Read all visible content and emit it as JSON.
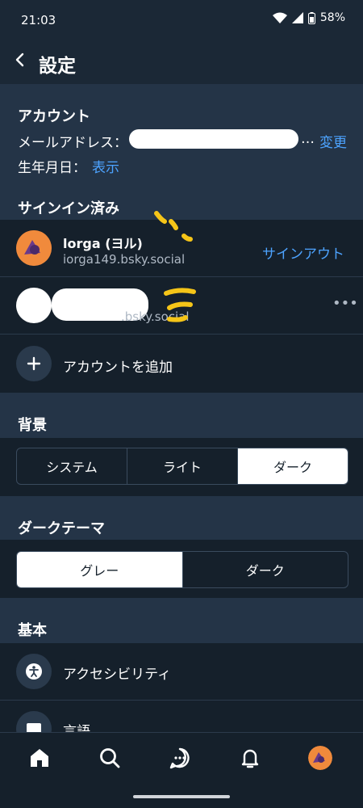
{
  "status": {
    "time": "21:03",
    "battery": "58%"
  },
  "header": {
    "title": "設定"
  },
  "account": {
    "heading": "アカウント",
    "email_label": "メールアドレス：",
    "email_ellipsis": "…",
    "change_link": "変更",
    "birthday_label": "生年月日：",
    "birthday_link": "表示"
  },
  "signed_in": {
    "heading": "サインイン済み",
    "accounts": [
      {
        "name": "lorga (ヨル)",
        "handle": "iorga149.bsky.social",
        "action": "サインアウト"
      },
      {
        "handle_partial": ".bsky.social"
      }
    ],
    "add_account": "アカウントを追加"
  },
  "background": {
    "heading": "背景",
    "options": [
      "システム",
      "ライト",
      "ダーク"
    ],
    "selected": "ダーク"
  },
  "dark_theme": {
    "heading": "ダークテーマ",
    "options": [
      "グレー",
      "ダーク"
    ],
    "selected": "グレー"
  },
  "basics": {
    "heading": "基本",
    "items": [
      {
        "label": "アクセシビリティ",
        "icon": "accessibility-icon"
      },
      {
        "label": "言語",
        "icon": "language-icon"
      }
    ]
  },
  "nav": [
    "home-icon",
    "search-icon",
    "chat-icon",
    "bell-icon",
    "profile-avatar"
  ],
  "colors": {
    "background": "#15202b",
    "section": "#243447",
    "accent": "#4da3ff"
  }
}
